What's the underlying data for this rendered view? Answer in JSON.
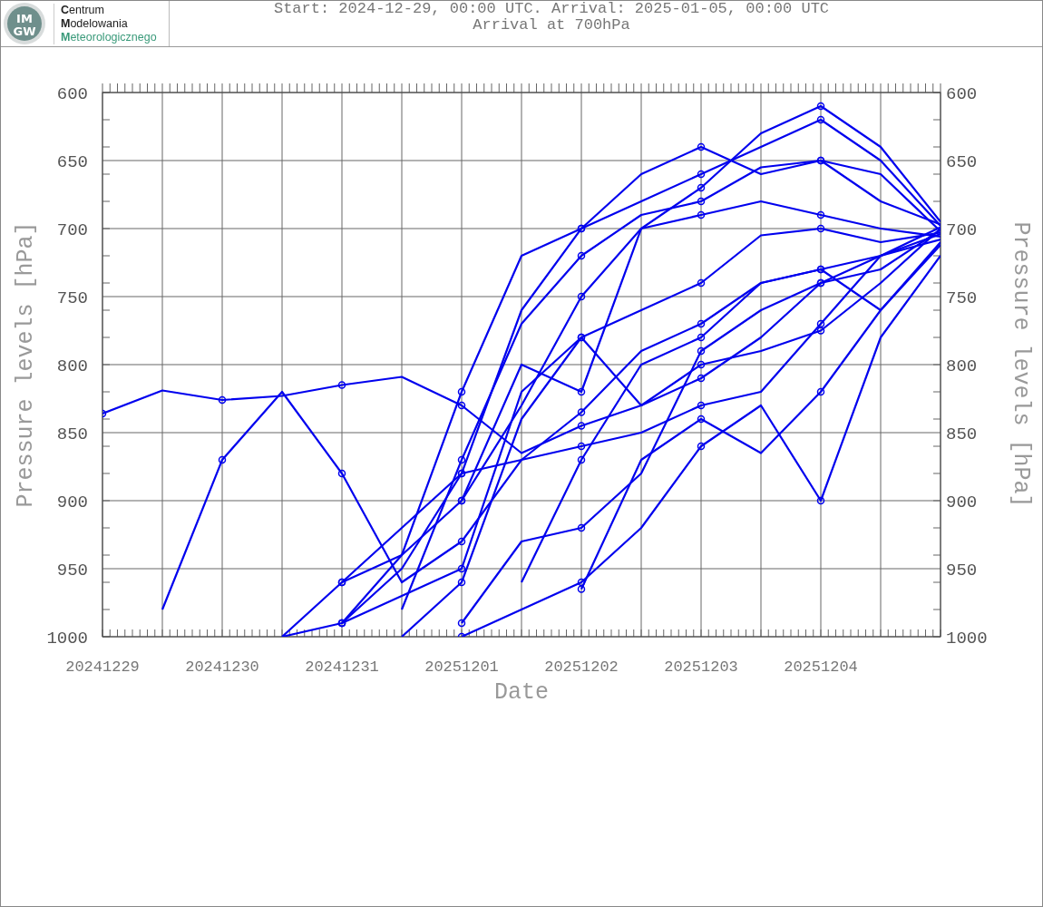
{
  "header": {
    "logo_badge": [
      "IM",
      "GW"
    ],
    "logo_lines": [
      {
        "text": "**C**entrum",
        "color": "#222222"
      },
      {
        "text": "**M**odelowania",
        "color": "#222222"
      },
      {
        "text": "**M**eteorologicznego",
        "color": "#3a9a7a"
      }
    ],
    "title_lines": [
      "Start: 2024-12-29, 00:00 UTC. Arrival: 2025-01-05, 00:00 UTC",
      "Arrival at 700hPa"
    ]
  },
  "chart_data": {
    "type": "line",
    "xlabel": "Date",
    "ylabel": "Pressure levels [hPa]",
    "categories": [
      "20241229",
      null,
      "20241230",
      null,
      "20241231",
      null,
      "20251201",
      null,
      "20251202",
      null,
      "20251203",
      null,
      "20251204",
      null,
      null
    ],
    "ylim": [
      1000,
      600
    ],
    "grid": true,
    "yticks": [
      600,
      650,
      700,
      750,
      800,
      850,
      900,
      950,
      1000
    ],
    "series": [
      {
        "color": "#0000ee",
        "values": [
          836,
          819,
          826,
          823,
          815,
          809,
          830,
          865,
          845,
          830,
          800,
          790,
          775,
          740,
          700
        ]
      },
      {
        "color": "#0000ee",
        "values": [
          null,
          980,
          870,
          820,
          880,
          960,
          930,
          870,
          835,
          790,
          770,
          740,
          730,
          720,
          704
        ]
      },
      {
        "color": "#0000ee",
        "values": [
          null,
          null,
          null,
          1000,
          960,
          940,
          900,
          830,
          750,
          700,
          690,
          680,
          690,
          700,
          706
        ]
      },
      {
        "color": "#0000ee",
        "values": [
          null,
          null,
          null,
          null,
          990,
          950,
          880,
          760,
          700,
          680,
          660,
          640,
          620,
          650,
          698
        ]
      },
      {
        "color": "#0000ee",
        "values": [
          null,
          null,
          null,
          null,
          null,
          980,
          870,
          770,
          720,
          690,
          680,
          655,
          650,
          660,
          702
        ]
      },
      {
        "color": "#0000ee",
        "values": [
          null,
          null,
          null,
          null,
          null,
          null,
          900,
          800,
          820,
          700,
          670,
          630,
          610,
          640,
          695
        ]
      },
      {
        "color": "#0000ee",
        "values": [
          null,
          null,
          null,
          null,
          960,
          920,
          880,
          870,
          860,
          850,
          830,
          820,
          770,
          720,
          708
        ]
      },
      {
        "color": "#0000ee",
        "values": [
          null,
          null,
          null,
          null,
          null,
          null,
          990,
          930,
          920,
          880,
          790,
          760,
          740,
          730,
          701
        ]
      },
      {
        "color": "#0000ee",
        "values": [
          null,
          null,
          null,
          null,
          null,
          null,
          null,
          null,
          965,
          870,
          840,
          865,
          820,
          760,
          712
        ]
      },
      {
        "color": "#0000ee",
        "values": [
          null,
          null,
          null,
          null,
          null,
          null,
          1000,
          980,
          960,
          920,
          860,
          830,
          900,
          780,
          720
        ]
      },
      {
        "color": "#0000ee",
        "values": [
          null,
          null,
          null,
          null,
          990,
          970,
          950,
          820,
          780,
          830,
          810,
          780,
          740,
          720,
          699
        ]
      },
      {
        "color": "#0000ee",
        "values": [
          null,
          null,
          null,
          null,
          null,
          1000,
          960,
          840,
          780,
          760,
          740,
          705,
          700,
          710,
          703
        ]
      },
      {
        "color": "#0000ee",
        "values": [
          null,
          null,
          null,
          1000,
          990,
          940,
          820,
          720,
          700,
          660,
          640,
          660,
          650,
          680,
          697
        ]
      },
      {
        "color": "#0000ee",
        "values": [
          null,
          null,
          null,
          null,
          null,
          null,
          null,
          960,
          870,
          800,
          780,
          740,
          730,
          760,
          710
        ]
      }
    ]
  },
  "right_axis": {
    "label": "Pressure levels [hPa]",
    "ticks": [
      "600",
      "650",
      "700",
      "750",
      "800",
      "850",
      "900",
      "950",
      "1000"
    ]
  }
}
